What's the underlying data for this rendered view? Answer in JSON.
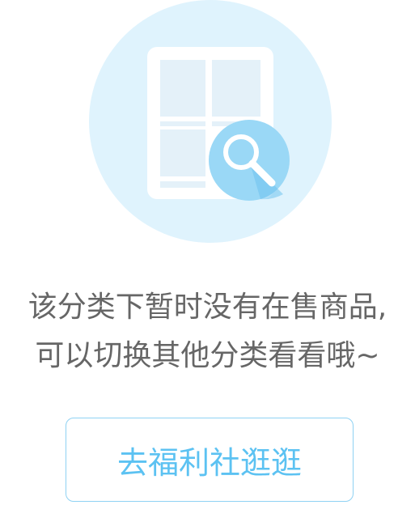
{
  "empty_state": {
    "illustration_icon": "document-search-icon",
    "message_line1": "该分类下暂时没有在售商品,",
    "message_line2": "可以切换其他分类看看哦~",
    "button_label": "去福利社逛逛"
  },
  "colors": {
    "circle_bg": "#dff3fd",
    "doc_bg": "#ffffff",
    "doc_panel": "#e4f1f9",
    "magnifier_bg": "#9ad8f6",
    "magnifier_shadow": "#6fc3ee",
    "text": "#666666",
    "button_text": "#5cc2f2",
    "button_border": "#8fd2f3"
  }
}
